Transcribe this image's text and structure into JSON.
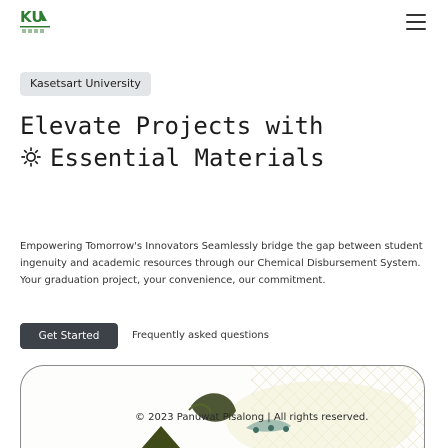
{
  "header": {
    "logo_text": "KU",
    "menu_icon": "hamburger-menu-icon"
  },
  "badge": {
    "label": "Kasetsart University"
  },
  "hero": {
    "title_line1": "Elevate Projects with",
    "title_line2": "Essential Materials",
    "title_icon": "gear-icon",
    "description": "Empowering Tomorrow's Innovators Seamlessly bridge the gap between student ingenuity and academic resources through our Chemical Disbursement System. Your graduation project, your convenience, our commitment."
  },
  "actions": {
    "primary_label": "Get Started",
    "faq_label": "Frequently asked questions"
  },
  "footer": {
    "copyright": "© 2023 Panuwat Pisalong | All rights reserved."
  },
  "colors": {
    "logo_green": "#2e7d32",
    "button_bg": "#3c4248",
    "badge_bg": "#e3e6e8"
  }
}
